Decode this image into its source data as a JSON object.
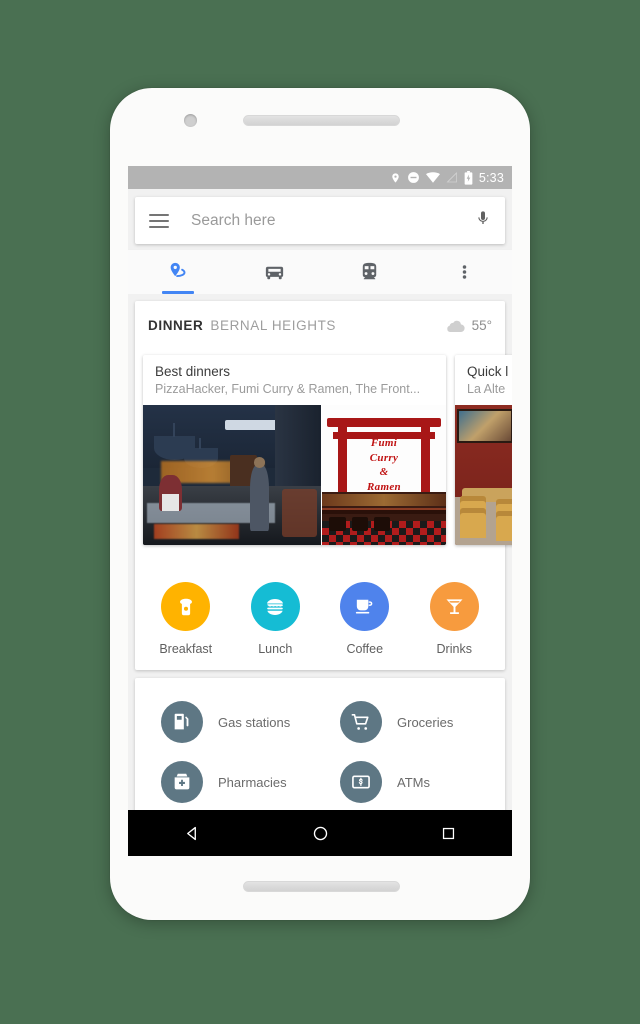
{
  "statusbar": {
    "icons": [
      "location-pin-icon",
      "do-not-disturb-icon",
      "wifi-icon",
      "cell-signal-off-icon",
      "battery-icon"
    ],
    "time": "5:33"
  },
  "search": {
    "placeholder": "Search here",
    "value": "",
    "menu_icon": "hamburger-menu-icon",
    "voice_icon": "microphone-icon"
  },
  "tabs": [
    {
      "name": "explore",
      "icon": "place-pin-icon",
      "active": true
    },
    {
      "name": "driving",
      "icon": "car-icon",
      "active": false
    },
    {
      "name": "transit",
      "icon": "train-icon",
      "active": false
    },
    {
      "name": "overflow",
      "icon": "more-vert-icon",
      "active": false
    }
  ],
  "context_header": {
    "meal": "DINNER",
    "neighborhood": "BERNAL HEIGHTS",
    "weather_icon": "cloud-icon",
    "temperature": "55°"
  },
  "place_cards": [
    {
      "title": "Best dinners",
      "subtitle": "PizzaHacker, Fumi Curry & Ramen, The Front...",
      "photos": [
        "restaurant-interior-photo",
        "fumi-curry-ramen-sign-photo",
        "red-wall-dining-room-photo"
      ],
      "photo2_sign_lines": [
        "Fumi",
        "Curry",
        "&",
        "Ramen"
      ]
    },
    {
      "title": "Quick l",
      "subtitle": "La Alte",
      "photos": [
        "taqueria-interior-photo"
      ]
    }
  ],
  "categories": [
    {
      "label": "Breakfast",
      "icon": "toast-icon",
      "color": "#FFB300"
    },
    {
      "label": "Lunch",
      "icon": "burger-icon",
      "color": "#15BCD4"
    },
    {
      "label": "Coffee",
      "icon": "coffee-cup-icon",
      "color": "#4F83EC"
    },
    {
      "label": "Drinks",
      "icon": "cocktail-glass-icon",
      "color": "#F79B3E"
    }
  ],
  "services": [
    {
      "label": "Gas stations",
      "icon": "gas-pump-icon"
    },
    {
      "label": "Groceries",
      "icon": "shopping-cart-icon"
    },
    {
      "label": "Pharmacies",
      "icon": "pharmacy-cross-icon"
    },
    {
      "label": "ATMs",
      "icon": "atm-cash-icon"
    }
  ],
  "navbar": [
    {
      "name": "back",
      "icon": "back-triangle-icon"
    },
    {
      "name": "home",
      "icon": "home-circle-icon"
    },
    {
      "name": "recents",
      "icon": "recents-square-icon"
    }
  ],
  "theme": {
    "background": "#4a7052",
    "accent": "#4285f4",
    "service_icon_bg": "#5e7784"
  }
}
